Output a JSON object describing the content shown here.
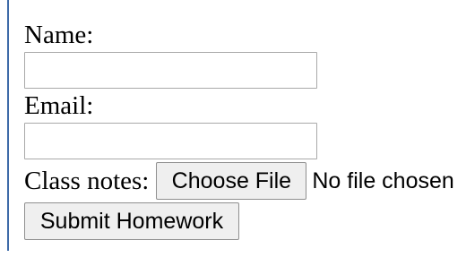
{
  "form": {
    "name_label": "Name:",
    "name_value": "",
    "email_label": "Email:",
    "email_value": "",
    "class_notes_label": "Class notes:",
    "choose_file_label": "Choose File",
    "file_status": "No file chosen",
    "submit_label": "Submit Homework"
  },
  "colors": {
    "left_rule": "#3e6aa8",
    "button_bg": "#efefef",
    "input_border": "#a9a9a9"
  }
}
